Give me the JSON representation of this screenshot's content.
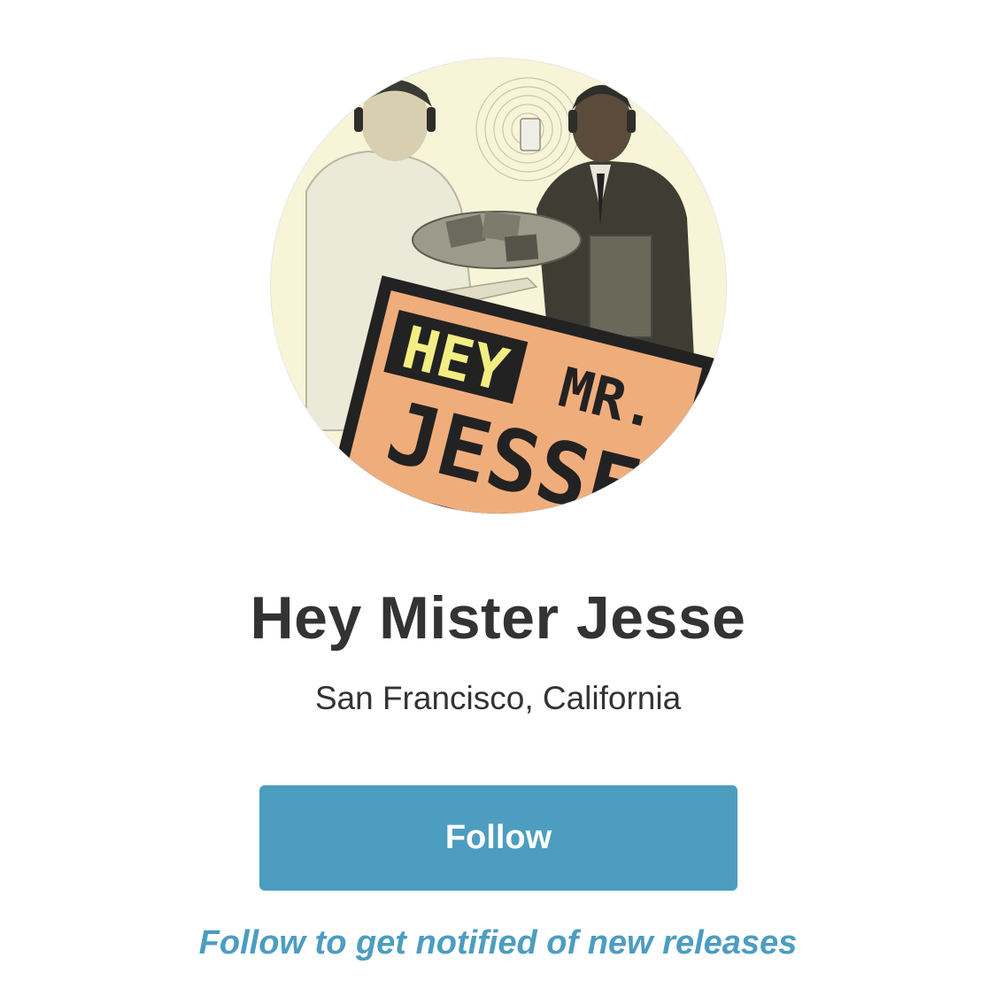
{
  "profile": {
    "avatar_alt": "",
    "logo_text": [
      "HEY",
      "MR.",
      "JESSE"
    ],
    "name": "Hey Mister Jesse",
    "location": "San Francisco, California"
  },
  "actions": {
    "follow_label": "Follow",
    "follow_hint": "Follow to get notified of new releases"
  },
  "colors": {
    "accent": "#4c9dc0",
    "text": "#333333",
    "background": "#ffffff",
    "logo_orange": "#f0ad7c",
    "logo_yellow": "#f2ee82",
    "avatar_bg": "#f7f4d8"
  }
}
